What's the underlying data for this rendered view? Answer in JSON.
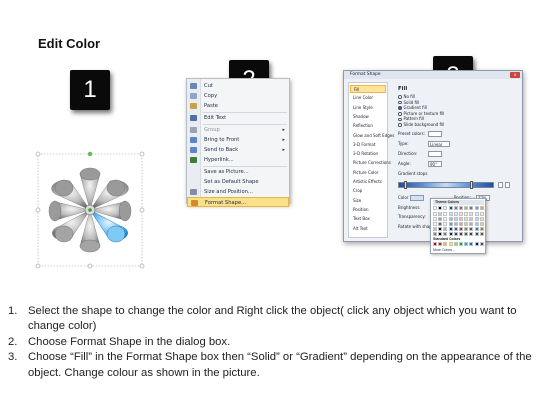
{
  "title": "Edit Color",
  "badges": [
    "1",
    "2",
    "3"
  ],
  "context_menu": {
    "items": [
      {
        "label": "Cut",
        "underline": "t",
        "icon": "scissors-icon",
        "color": "#6b86b5",
        "sub": false,
        "highlight": false,
        "disabled": false
      },
      {
        "label": "Copy",
        "underline": "C",
        "icon": "copy-icon",
        "color": "#8fa5c7",
        "sub": false,
        "highlight": false,
        "disabled": false
      },
      {
        "label": "Paste",
        "underline": "P",
        "icon": "paste-icon",
        "color": "#c8a24a",
        "sub": false,
        "highlight": false,
        "disabled": false
      },
      {
        "label": "Edit Text",
        "underline": "x",
        "icon": "edit-text-icon",
        "color": "#4d6ea6",
        "sub": false,
        "highlight": false,
        "disabled": false,
        "sep_before": true
      },
      {
        "label": "Group",
        "underline": "G",
        "icon": "group-icon",
        "color": "#9aa3b2",
        "sub": true,
        "highlight": false,
        "disabled": true,
        "sep_before": true
      },
      {
        "label": "Bring to Front",
        "underline": "r",
        "icon": "bring-front-icon",
        "color": "#5d84c4",
        "sub": true,
        "highlight": false,
        "disabled": false
      },
      {
        "label": "Send to Back",
        "underline": "k",
        "icon": "send-back-icon",
        "color": "#5d84c4",
        "sub": true,
        "highlight": false,
        "disabled": false
      },
      {
        "label": "Hyperlink...",
        "underline": "H",
        "icon": "hyperlink-icon",
        "color": "#3f7d3a",
        "sub": false,
        "highlight": false,
        "disabled": false
      },
      {
        "label": "Save as Picture...",
        "underline": "S",
        "icon": "",
        "color": "",
        "sub": false,
        "highlight": false,
        "disabled": false,
        "sep_before": true
      },
      {
        "label": "Set as Default Shape",
        "underline": "D",
        "icon": "",
        "color": "",
        "sub": false,
        "highlight": false,
        "disabled": false
      },
      {
        "label": "Size and Position...",
        "underline": "z",
        "icon": "size-position-icon",
        "color": "#7f8fa8",
        "sub": false,
        "highlight": false,
        "disabled": false
      },
      {
        "label": "Format Shape...",
        "underline": "o",
        "icon": "format-shape-icon",
        "color": "#d18b2a",
        "sub": false,
        "highlight": true,
        "disabled": false
      }
    ]
  },
  "format_dialog": {
    "title": "Format Shape",
    "close": "x",
    "nav": [
      "Fill",
      "Line Color",
      "Line Style",
      "Shadow",
      "Reflection",
      "Glow and Soft Edges",
      "3-D Format",
      "3-D Rotation",
      "Picture Corrections",
      "Picture Color",
      "Artistic Effects",
      "Crop",
      "Size",
      "Position",
      "Text Box",
      "Alt Text"
    ],
    "nav_selected": 0,
    "section_title": "Fill",
    "radios": [
      {
        "label": "No fill",
        "on": false
      },
      {
        "label": "Solid fill",
        "on": false
      },
      {
        "label": "Gradient fill",
        "on": true
      },
      {
        "label": "Picture or texture fill",
        "on": false
      },
      {
        "label": "Pattern fill",
        "on": false
      },
      {
        "label": "Slide background fill",
        "on": false
      }
    ],
    "preset_label": "Preset colors:",
    "type_label": "Type:",
    "type_value": "Linear",
    "direction_label": "Direction:",
    "angle_label": "Angle:",
    "angle_value": "90°",
    "gradient_stops_label": "Gradient stops",
    "color_label": "Color",
    "position_label": "Position:",
    "position_value": "77%",
    "brightness_label": "Brightness:",
    "transparency_label": "Transparency:",
    "rotate_label": "Rotate with shape"
  },
  "palette": {
    "theme_title": "Theme Colors",
    "standard_title": "Standard Colors",
    "more_label": "More Colors...",
    "theme_columns": [
      "#ffffff",
      "#000000",
      "#eeece1",
      "#1f497d",
      "#4f81bd",
      "#c0504d",
      "#9bbb59",
      "#8064a2",
      "#4bacc6",
      "#f79646"
    ],
    "standard": [
      "#c00000",
      "#ff0000",
      "#ffc000",
      "#ffff00",
      "#92d050",
      "#00b050",
      "#00b0f0",
      "#0070c0",
      "#002060",
      "#7030a0"
    ]
  },
  "steps": [
    {
      "num": "1.",
      "text": "Select the shape to change the color and Right click the object( click any object which you want to change color)"
    },
    {
      "num": "2.",
      "text": "Choose Format Shape in the dialog box."
    },
    {
      "num": "3.",
      "text": "Choose “Fill” in the Format Shape box then “Solid” or “Gradient” depending on the appearance of the object. Change colour as shown in the picture."
    }
  ]
}
